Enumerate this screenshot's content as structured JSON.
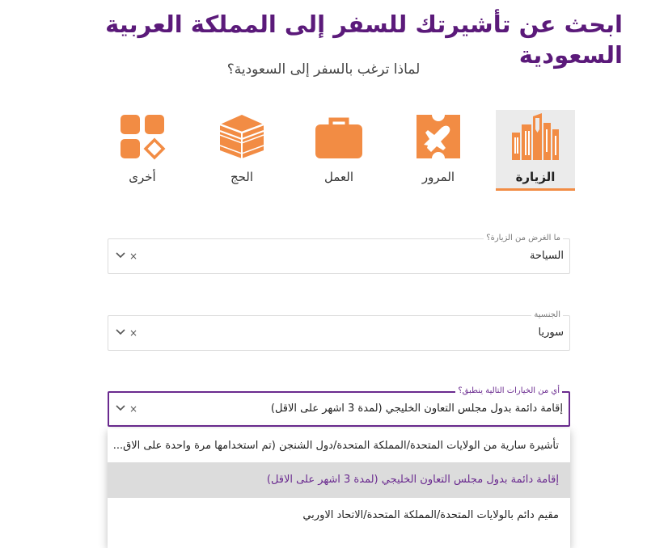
{
  "heading": "ابحث عن تأشيرتك للسفر إلى المملكة العربية السعودية",
  "subheading": "لماذا ترغب بالسفر إلى السعودية؟",
  "purposes": [
    {
      "label": "الزيارة",
      "icon": "city-buildings-icon",
      "active": true
    },
    {
      "label": "المرور",
      "icon": "airplane-ticket-icon",
      "active": false
    },
    {
      "label": "العمل",
      "icon": "briefcase-icon",
      "active": false
    },
    {
      "label": "الحج",
      "icon": "kaaba-icon",
      "active": false
    },
    {
      "label": "أخرى",
      "icon": "grid-shapes-icon",
      "active": false
    }
  ],
  "fields": {
    "visit_purpose": {
      "label": "ما الغرض من الزيارة؟",
      "value": "السياحة"
    },
    "nationality": {
      "label": "الجنسية",
      "value": "سوريا"
    },
    "applicable_options": {
      "label": "أي من الخيارات التالية ينطبق؟",
      "value": "إقامة دائمة بدول مجلس التعاون الخليجي (لمدة 3 اشهر على الاقل)"
    }
  },
  "clear_symbol": "×",
  "dropdown_options": [
    {
      "label": "تأشيرة سارية من الولايات المتحدة/المملكة المتحدة/دول الشنجن (تم استخدامها مرة واحدة على الاق...",
      "selected": false
    },
    {
      "label": "إقامة دائمة بدول مجلس التعاون الخليجي (لمدة 3 اشهر على الاقل)",
      "selected": true
    },
    {
      "label": "مقيم دائم بالولايات المتحدة/المملكة المتحدة/الاتحاد الاوربي",
      "selected": false
    }
  ],
  "colors": {
    "accent": "#f28c44",
    "brand_purple": "#5b1a7a",
    "focus": "#6a2a8f",
    "selected_bg": "#dcdcdc"
  }
}
